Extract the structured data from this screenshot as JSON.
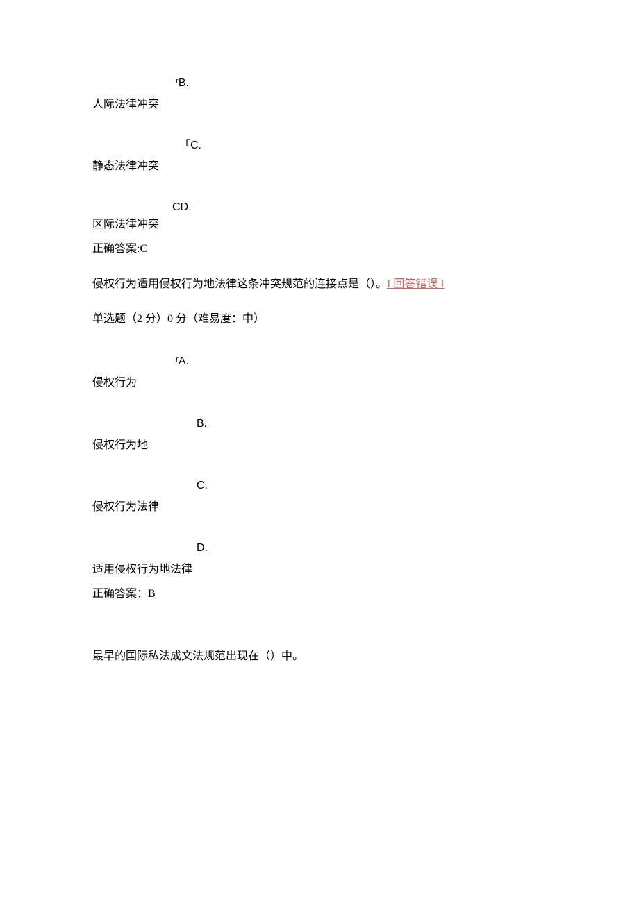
{
  "q1": {
    "optionB": {
      "label": "ʳB.",
      "text": "人际法律冲突"
    },
    "optionC": {
      "label": "「C.",
      "text": "静态法律冲突"
    },
    "optionD": {
      "label": "CD.",
      "text": "区际法律冲突"
    },
    "answer": "正确答案:C"
  },
  "q2": {
    "question_text": "侵权行为适用侵权行为地法律这条冲突规范的连接点是（）。",
    "error_badge": "I 回答错误 I",
    "type_line": "单选题（2 分）0 分（难易度：中）",
    "optionA": {
      "label": "ʳA.",
      "text": "侵权行为"
    },
    "optionB": {
      "label": "B.",
      "text": "侵权行为地"
    },
    "optionC": {
      "label": "C.",
      "text": "侵权行为法律"
    },
    "optionD": {
      "label": "D.",
      "text": "适用侵权行为地法律"
    },
    "answer": "正确答案：B"
  },
  "q3": {
    "question_text": "最早的国际私法成文法规范出现在（）中。"
  }
}
